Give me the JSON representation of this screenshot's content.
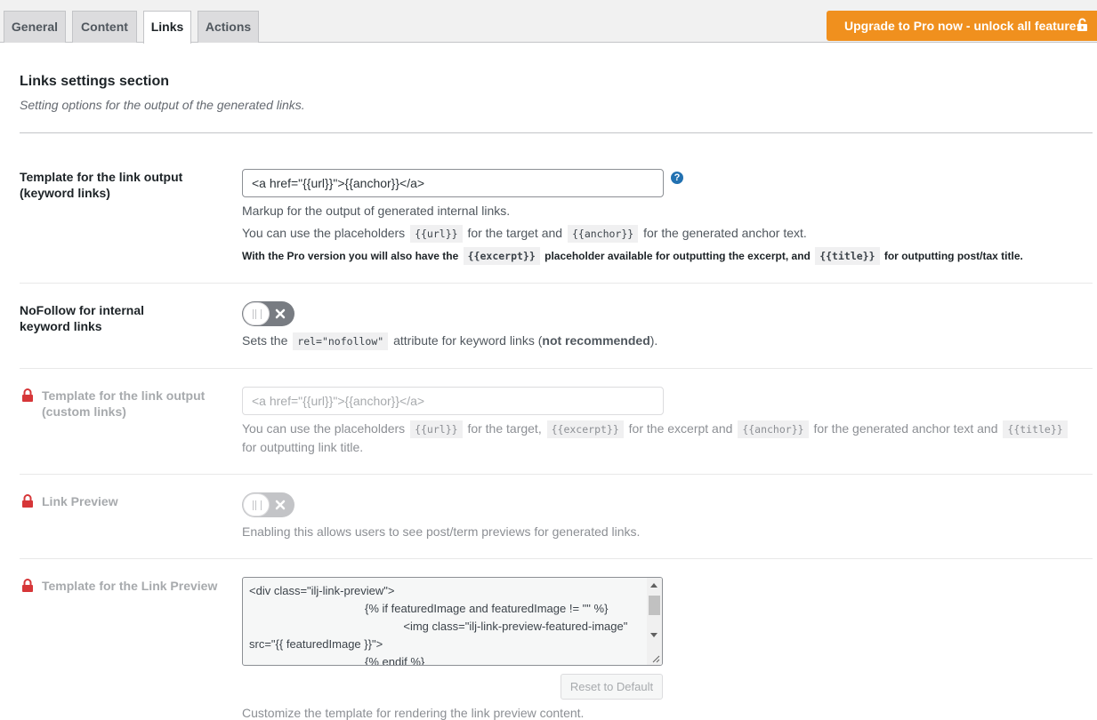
{
  "tabs": [
    {
      "label": "General"
    },
    {
      "label": "Content"
    },
    {
      "label": "Links"
    },
    {
      "label": "Actions"
    }
  ],
  "active_tab": "Links",
  "upgrade_button": {
    "label": "Upgrade to Pro now - unlock all features",
    "color": "#f0901e"
  },
  "section": {
    "title": "Links settings section",
    "description": "Setting options for the output of the generated links."
  },
  "keyword_template": {
    "label": "Template for the link output (keyword links)",
    "value": "<a href=\"{{url}}\">{{anchor}}</a>",
    "help_icon": "question-mark-icon",
    "desc1": "Markup for the output of generated internal links.",
    "desc2": {
      "part1": "You can use the placeholders",
      "code1": "{{url}}",
      "part2": "for the target and",
      "code2": "{{anchor}}",
      "part3": "for the generated anchor text."
    },
    "desc3": {
      "part1": "With the Pro version you will also have the",
      "code1": "{{excerpt}}",
      "part2": "placeholder available for outputting the excerpt, and",
      "code2": "{{title}}",
      "part3": "for outputting post/tax title."
    }
  },
  "nofollow": {
    "label": "NoFollow for internal keyword links",
    "enabled": false,
    "desc": {
      "part1": "Sets the",
      "code": "rel=\"nofollow\"",
      "part2": "attribute for keyword links (",
      "bold": "not recommended",
      "part3": ")."
    }
  },
  "custom_template": {
    "label": "Template for the link output (custom links)",
    "placeholder": "<a href=\"{{url}}\">{{anchor}}</a>",
    "desc": {
      "part1": "You can use the placeholders",
      "code1": "{{url}}",
      "part2": "for the target,",
      "code2": "{{excerpt}}",
      "part3": "for the excerpt and",
      "code3": "{{anchor}}",
      "part4": "for the generated anchor text and",
      "code4": "{{title}}",
      "line2": "for outputting link title."
    }
  },
  "link_preview": {
    "label": "Link Preview",
    "enabled": false,
    "desc": "Enabling this allows users to see post/term previews for generated links."
  },
  "preview_template": {
    "label": "Template for the Link Preview",
    "content": "<div class=\"ilj-link-preview\">\n                                    {% if featuredImage and featuredImage != \"\" %}\n                                                <img class=\"ilj-link-preview-featured-image\" src=\"{{ featuredImage }}\">\n                                    {% endif %}",
    "reset_label": "Reset to Default",
    "desc": "Customize the template for rendering the link preview content."
  }
}
